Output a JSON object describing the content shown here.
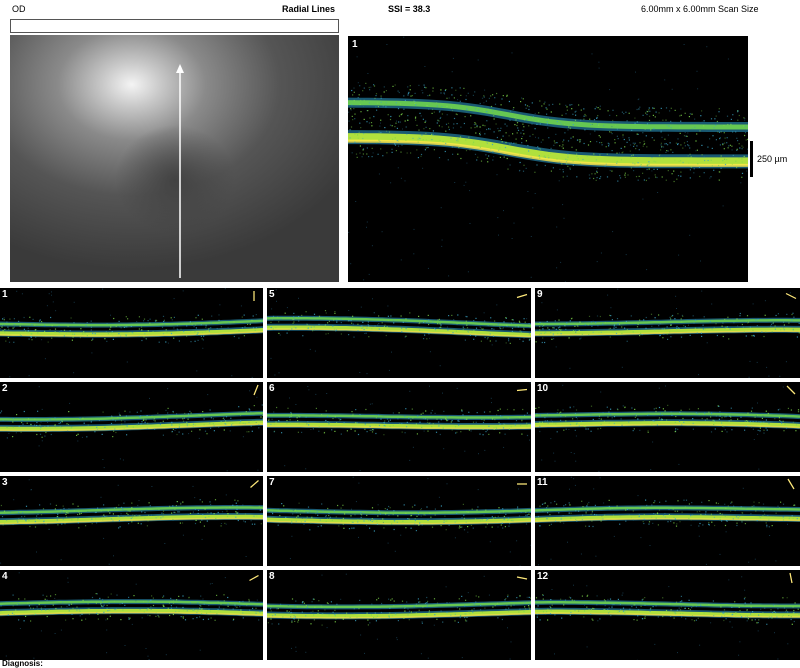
{
  "header": {
    "eye": "OD",
    "title": "Radial Lines",
    "ssi": "SSI = 38.3",
    "scan_size": "6.00mm x 6.00mm Scan Size"
  },
  "main_scan": {
    "number": "1",
    "scale_label": "250 µm"
  },
  "scans": [
    {
      "number": "1"
    },
    {
      "number": "2"
    },
    {
      "number": "3"
    },
    {
      "number": "4"
    },
    {
      "number": "5"
    },
    {
      "number": "6"
    },
    {
      "number": "7"
    },
    {
      "number": "8"
    },
    {
      "number": "9"
    },
    {
      "number": "10"
    },
    {
      "number": "11"
    },
    {
      "number": "12"
    }
  ],
  "footer": {
    "diagnosis": "Diagnosis:"
  }
}
